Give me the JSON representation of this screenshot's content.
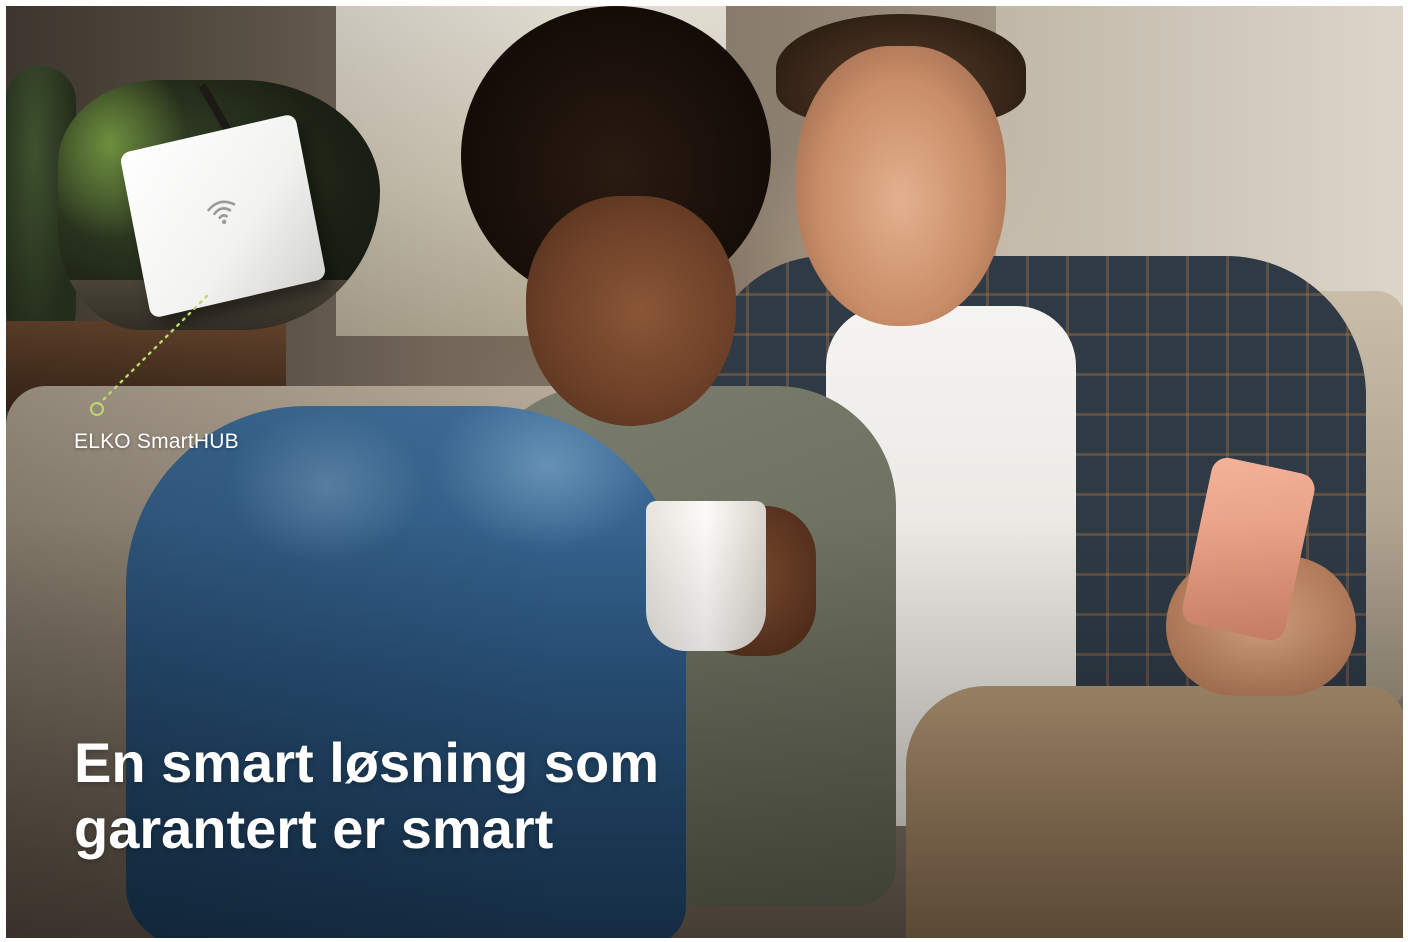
{
  "product": {
    "label": "ELKO SmartHUB",
    "icon": "wifi-icon"
  },
  "headline": {
    "line1": "En smart løsning som",
    "line2": "garantert er smart"
  },
  "colors": {
    "accent": "#b9d96b",
    "text": "#ffffff"
  }
}
